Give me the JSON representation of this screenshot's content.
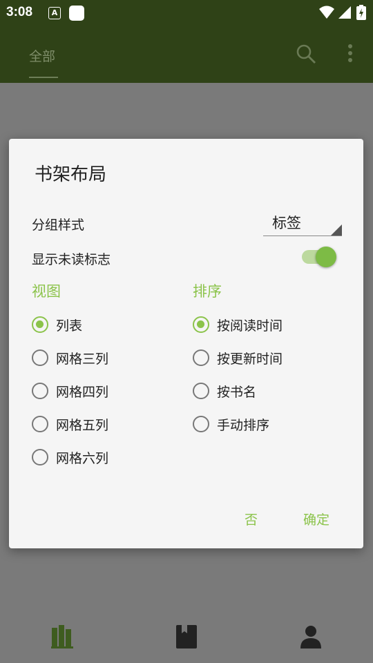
{
  "status_bar": {
    "time": "3:08",
    "notif_icon_letter": "A"
  },
  "app_bar": {
    "tab_all": "全部",
    "search_icon": "search-icon",
    "more_icon": "more-vert-icon"
  },
  "bottom_nav": {
    "items": [
      "bookshelf-icon",
      "book-icon",
      "person-icon"
    ]
  },
  "dialog": {
    "title": "书架布局",
    "group_style_label": "分组样式",
    "group_style_value": "标签",
    "show_unread_label": "显示未读标志",
    "show_unread_on": true,
    "view_heading": "视图",
    "view_options": [
      "列表",
      "网格三列",
      "网格四列",
      "网格五列",
      "网格六列"
    ],
    "view_selected": "列表",
    "sort_heading": "排序",
    "sort_options": [
      "按阅读时间",
      "按更新时间",
      "按书名",
      "手动排序"
    ],
    "sort_selected": "按阅读时间",
    "cancel_label": "否",
    "confirm_label": "确定"
  },
  "colors": {
    "accent": "#8bc34a",
    "appbar": "#2f4217",
    "scrim": "#7a7a7a"
  }
}
